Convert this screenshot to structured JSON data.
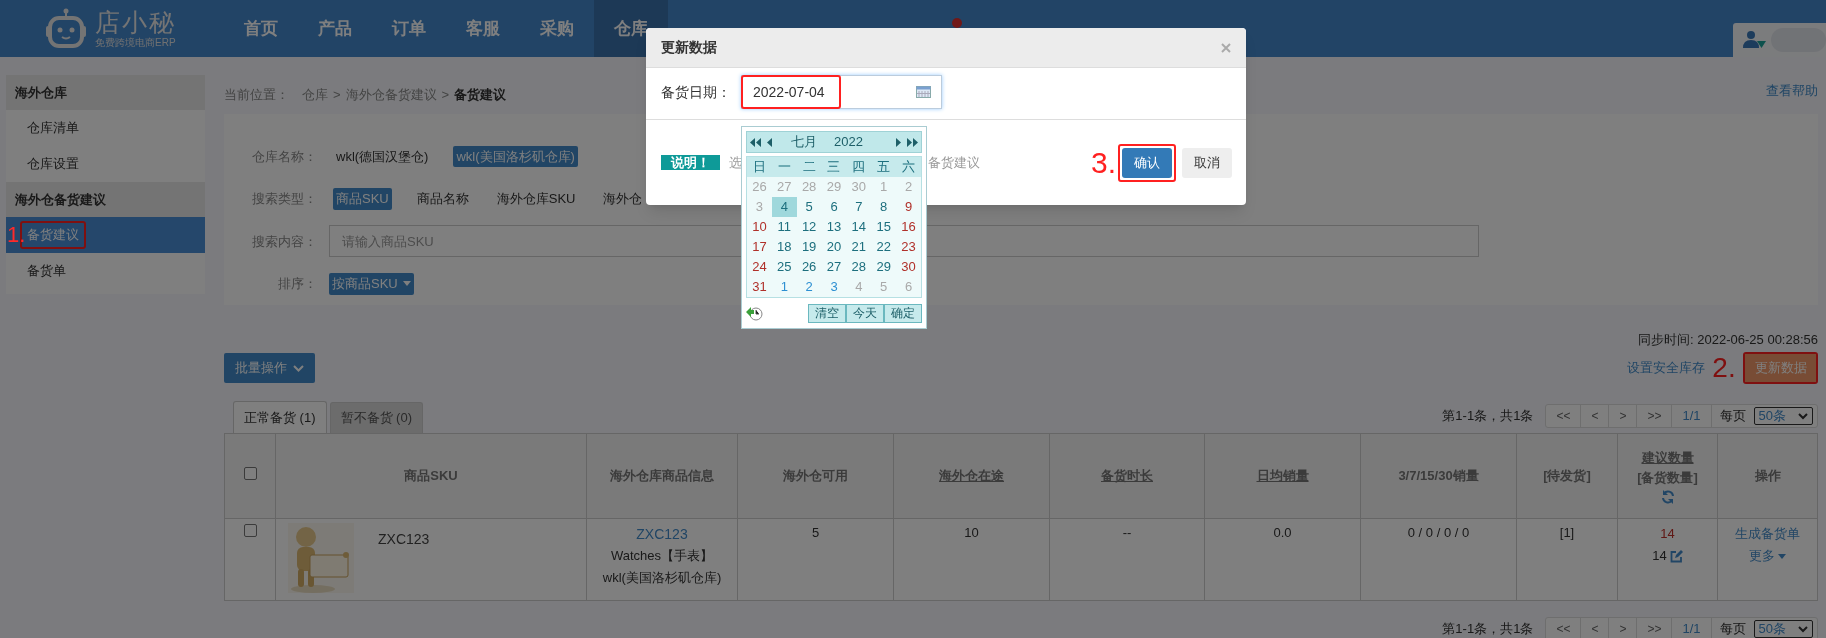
{
  "logo": {
    "name": "店小秘",
    "tagline": "免费跨境电商ERP"
  },
  "nav": [
    {
      "label": "首页",
      "selected": false
    },
    {
      "label": "产品",
      "selected": false
    },
    {
      "label": "订单",
      "selected": false
    },
    {
      "label": "客服",
      "selected": false
    },
    {
      "label": "采购",
      "selected": false
    },
    {
      "label": "仓库",
      "selected": true
    }
  ],
  "sidebar": [
    {
      "title": "海外仓库",
      "items": [
        {
          "label": "仓库清单",
          "selected": false,
          "highlighted": false
        },
        {
          "label": "仓库设置",
          "selected": false,
          "highlighted": false
        }
      ]
    },
    {
      "title": "海外仓备货建议",
      "items": [
        {
          "label": "备货建议",
          "selected": true,
          "highlighted": true
        },
        {
          "label": "备货单",
          "selected": false,
          "highlighted": false
        }
      ]
    }
  ],
  "breadcrumb": [
    {
      "kind": "label",
      "text": "当前位置："
    },
    {
      "kind": "link",
      "text": "仓库"
    },
    {
      "kind": "separator",
      "text": ">"
    },
    {
      "kind": "link",
      "text": "海外仓备货建议"
    },
    {
      "kind": "separator",
      "text": ">"
    },
    {
      "kind": "current",
      "text": "备货建议"
    }
  ],
  "help_link": "查看帮助",
  "filters": [
    {
      "kind": "options",
      "label": "仓库名称：",
      "options": [
        {
          "label": "wkl(德国汉堡仓)",
          "selected": false
        },
        {
          "label": "wkl(美国洛杉矶仓库)",
          "selected": true
        }
      ]
    },
    {
      "kind": "options",
      "label": "搜索类型：",
      "options": [
        {
          "label": "商品SKU",
          "selected": true
        },
        {
          "label": "商品名称",
          "selected": false
        },
        {
          "label": "海外仓库SKU",
          "selected": false
        },
        {
          "label": "海外仓",
          "selected": false
        }
      ]
    },
    {
      "kind": "input",
      "label": "搜索内容：",
      "placeholder": "请输入商品SKU"
    },
    {
      "kind": "dropdown",
      "label": "排序：",
      "value": "按商品SKU"
    }
  ],
  "sync_time": "同步时间: 2022-06-25 00:28:56",
  "bulk_button": "批量操作",
  "safety_stock_link": "设置安全库存",
  "update_button": {
    "label": "更新数据",
    "highlighted": true
  },
  "tabs": [
    {
      "label": "正常备货 (1)",
      "selected": true
    },
    {
      "label": "暂不备货 (0)",
      "selected": false
    }
  ],
  "pagination_top": {
    "summary": "第1-1条，共1条",
    "buttons": [
      "<<",
      "<",
      ">",
      ">>"
    ],
    "page": "1/1",
    "per_page_label": "每页",
    "per_page": "50条"
  },
  "table": {
    "columns": [
      {
        "kind": "checkbox",
        "checked": false
      },
      {
        "kind": "text",
        "label": "商品SKU"
      },
      {
        "kind": "text",
        "label": "海外仓库商品信息"
      },
      {
        "kind": "text",
        "label": "海外仓可用"
      },
      {
        "kind": "sortable",
        "label": "海外仓在途"
      },
      {
        "kind": "sortable",
        "label": "备货时长"
      },
      {
        "kind": "sortable",
        "label": "日均销量"
      },
      {
        "kind": "text",
        "label": "3/7/15/30销量"
      },
      {
        "kind": "text",
        "label": "[待发货]"
      },
      {
        "kind": "quantity",
        "label": "建议数量",
        "sublabel": "[备货数量]"
      },
      {
        "kind": "text",
        "label": "操作"
      }
    ],
    "rows": [
      {
        "checked": false,
        "sku": "ZXC123",
        "info_link": "ZXC123",
        "info_name": "Watches【手表】",
        "info_warehouse": "wkl(美国洛杉矶仓库)",
        "available": "5",
        "in_transit": "10",
        "lead_time": "--",
        "daily_sales": "0.0",
        "sales": "0 / 0 / 0 / 0",
        "pending": "[1]",
        "suggested": "14",
        "stock_qty": "14",
        "action": "生成备货单",
        "more": "更多"
      }
    ]
  },
  "pagination_bottom": {
    "summary": "第1-1条，共1条",
    "buttons": [
      "<<",
      "<",
      ">",
      ">>"
    ],
    "page": "1/1",
    "per_page_label": "每页",
    "per_page": "50条"
  },
  "modal": {
    "title": "更新数据",
    "date_label": "备货日期：",
    "date_value": "2022-07-04",
    "date_highlighted": true,
    "note_badge": "说明！",
    "note_start": "选",
    "note_end": "备货建议",
    "confirm": "确认",
    "confirm_highlighted": true,
    "cancel": "取消"
  },
  "datepicker": {
    "month": "七月",
    "year": "2022",
    "weekdays": [
      "日",
      "一",
      "二",
      "三",
      "四",
      "五",
      "六"
    ],
    "days": [
      {
        "label": "26",
        "kind": "muted",
        "selected": false
      },
      {
        "label": "27",
        "kind": "muted",
        "selected": false
      },
      {
        "label": "28",
        "kind": "muted",
        "selected": false
      },
      {
        "label": "29",
        "kind": "muted",
        "selected": false
      },
      {
        "label": "30",
        "kind": "muted",
        "selected": false
      },
      {
        "label": "1",
        "kind": "muted",
        "selected": false
      },
      {
        "label": "2",
        "kind": "muted",
        "selected": false
      },
      {
        "label": "3",
        "kind": "muted",
        "selected": false
      },
      {
        "label": "4",
        "kind": "normal",
        "selected": true
      },
      {
        "label": "5",
        "kind": "normal",
        "selected": false
      },
      {
        "label": "6",
        "kind": "normal",
        "selected": false
      },
      {
        "label": "7",
        "kind": "normal",
        "selected": false
      },
      {
        "label": "8",
        "kind": "normal",
        "selected": false
      },
      {
        "label": "9",
        "kind": "weekend",
        "selected": false
      },
      {
        "label": "10",
        "kind": "weekend",
        "selected": false
      },
      {
        "label": "11",
        "kind": "normal",
        "selected": false
      },
      {
        "label": "12",
        "kind": "normal",
        "selected": false
      },
      {
        "label": "13",
        "kind": "normal",
        "selected": false
      },
      {
        "label": "14",
        "kind": "normal",
        "selected": false
      },
      {
        "label": "15",
        "kind": "normal",
        "selected": false
      },
      {
        "label": "16",
        "kind": "weekend",
        "selected": false
      },
      {
        "label": "17",
        "kind": "weekend",
        "selected": false
      },
      {
        "label": "18",
        "kind": "normal",
        "selected": false
      },
      {
        "label": "19",
        "kind": "normal",
        "selected": false
      },
      {
        "label": "20",
        "kind": "normal",
        "selected": false
      },
      {
        "label": "21",
        "kind": "normal",
        "selected": false
      },
      {
        "label": "22",
        "kind": "normal",
        "selected": false
      },
      {
        "label": "23",
        "kind": "weekend",
        "selected": false
      },
      {
        "label": "24",
        "kind": "weekend",
        "selected": false
      },
      {
        "label": "25",
        "kind": "normal",
        "selected": false
      },
      {
        "label": "26",
        "kind": "normal",
        "selected": false
      },
      {
        "label": "27",
        "kind": "normal",
        "selected": false
      },
      {
        "label": "28",
        "kind": "normal",
        "selected": false
      },
      {
        "label": "29",
        "kind": "normal",
        "selected": false
      },
      {
        "label": "30",
        "kind": "weekend",
        "selected": false
      },
      {
        "label": "31",
        "kind": "weekend",
        "selected": false
      },
      {
        "label": "1",
        "kind": "next",
        "selected": false
      },
      {
        "label": "2",
        "kind": "next",
        "selected": false
      },
      {
        "label": "3",
        "kind": "next",
        "selected": false
      },
      {
        "label": "4",
        "kind": "muted",
        "selected": false
      },
      {
        "label": "5",
        "kind": "muted",
        "selected": false
      },
      {
        "label": "6",
        "kind": "muted",
        "selected": false
      }
    ],
    "buttons": [
      "清空",
      "今天",
      "确定"
    ]
  },
  "annotations": [
    "1.",
    "2.",
    "3."
  ]
}
